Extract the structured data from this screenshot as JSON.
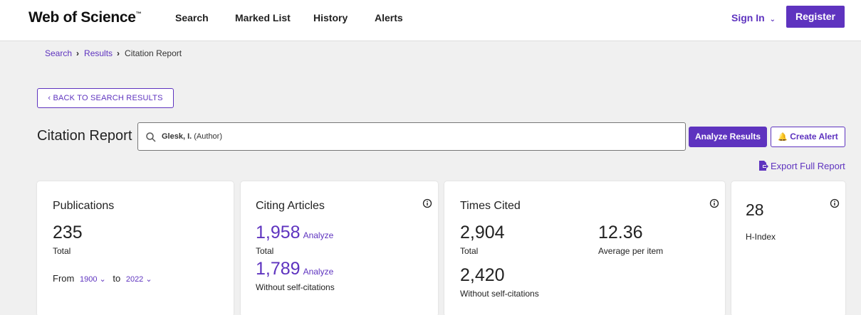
{
  "header": {
    "logo": "Web of Science",
    "logo_tm": "™",
    "nav": [
      "Search",
      "Marked List",
      "History",
      "Alerts"
    ],
    "sign_in": "Sign In",
    "register": "Register"
  },
  "breadcrumb": {
    "items": [
      "Search",
      "Results",
      "Citation Report"
    ]
  },
  "back_button": "‹ BACK TO SEARCH RESULTS",
  "report": {
    "title": "Citation Report",
    "query_name": "Glesk, I.",
    "query_field": "(Author)",
    "analyze_button": "Analyze Results",
    "alert_button": "Create Alert",
    "export": "Export Full Report"
  },
  "publications": {
    "title": "Publications",
    "total": "235",
    "total_label": "Total",
    "from_label": "From",
    "from_year": "1900",
    "to_label": "to",
    "to_year": "2022"
  },
  "citing": {
    "title": "Citing Articles",
    "total": "1,958",
    "total_label": "Total",
    "without_self": "1,789",
    "without_self_label": "Without self-citations",
    "analyze": "Analyze"
  },
  "times_cited": {
    "title": "Times Cited",
    "total": "2,904",
    "total_label": "Total",
    "average": "12.36",
    "average_label": "Average per item",
    "without_self": "2,420",
    "without_self_label": "Without self-citations"
  },
  "h_index": {
    "value": "28",
    "label": "H-Index"
  },
  "colors": {
    "accent": "#5e33bf",
    "background": "#f0f0f0"
  }
}
